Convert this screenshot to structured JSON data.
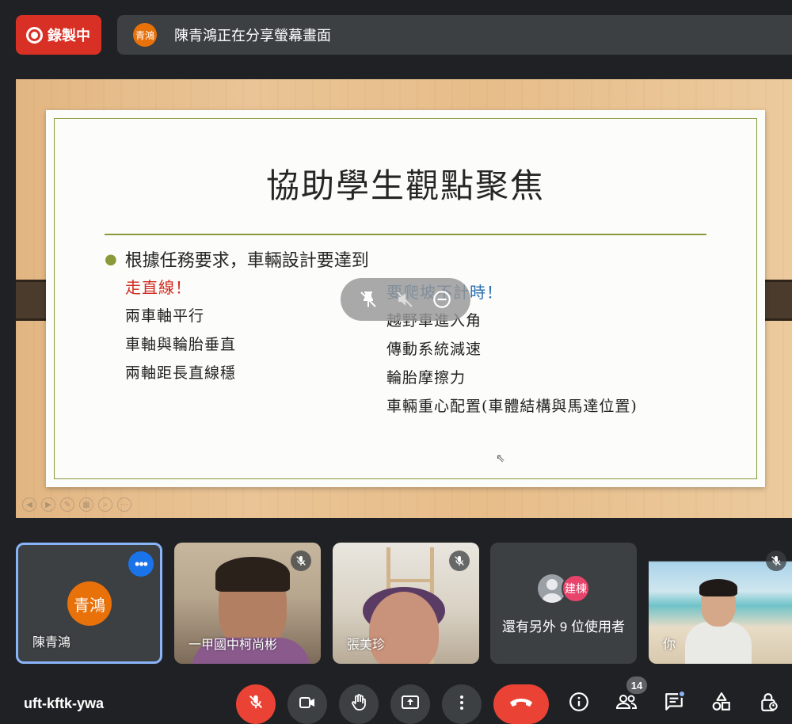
{
  "recording": {
    "label": "錄製中"
  },
  "presenter_banner": {
    "avatar_initials": "青鴻",
    "text": "陳青鴻正在分享螢幕畫面"
  },
  "slide": {
    "title": "協助學生觀點聚焦",
    "bullet": "根據任務要求，車輛設計要達到",
    "left_heading": "走直線！",
    "left_items": [
      "兩車軸平行",
      "車軸與輪胎垂直",
      "兩軸距長直線穩"
    ],
    "right_heading": "要爬坡不計時！",
    "right_items": [
      "越野車進入角",
      "傳動系統減速",
      "輪胎摩擦力",
      "車輛重心配置(車體結構與馬達位置)"
    ]
  },
  "participants": [
    {
      "name": "陳青鴻",
      "avatar_initials": "青鴻"
    },
    {
      "name": "一甲國中柯尚彬"
    },
    {
      "name": "張美珍"
    },
    {
      "name": "還有另外 9 位使用者",
      "avatar_initials": "建棟"
    },
    {
      "name": "你"
    }
  ],
  "meeting_code": "uft-kftk-ywa",
  "participant_count": "14",
  "colors": {
    "accent": "#8ab4f8",
    "recording": "#d93025",
    "hangup": "#ea4335",
    "avatar_orange": "#e8710a"
  },
  "icons": [
    "mic-off-icon",
    "camera-icon",
    "raise-hand-icon",
    "present-icon",
    "more-vert-icon",
    "hang-up-icon",
    "info-icon",
    "people-icon",
    "chat-icon",
    "activities-icon",
    "host-controls-icon"
  ]
}
